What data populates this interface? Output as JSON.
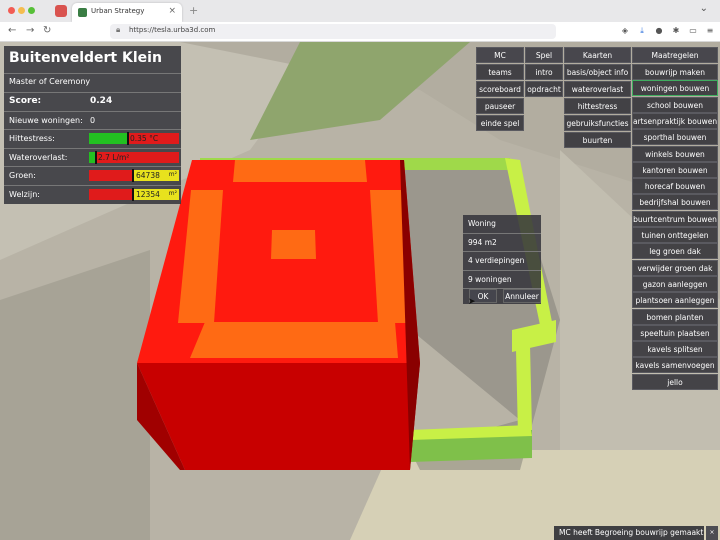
{
  "browser": {
    "tab_title": "Urban Strategy",
    "tab_close": "×",
    "new_tab": "+",
    "menu": "⌄",
    "url": "https://tesla.urba3d.com",
    "back": "←",
    "forward": "→",
    "reload": "↻"
  },
  "panel": {
    "title": "Buitenveldert Klein",
    "role": "Master of Ceremony",
    "score_label": "Score:",
    "score_value": "0.24",
    "woningen_label": "Nieuwe woningen:",
    "woningen_value": "0",
    "hittestress_label": "Hittestress:",
    "hittestress_value": "0.35 °C",
    "hittestress_fill": 0.42,
    "wateroverlast_label": "Wateroverlast:",
    "wateroverlast_value": "2.7 L/m²",
    "wateroverlast_fill": 0.07,
    "groen_label": "Groen:",
    "groen_value": "64738",
    "groen_unit": "m²",
    "groen_fill": 0.5,
    "welzijn_label": "Welzijn:",
    "welzijn_value": "12354",
    "welzijn_unit": "m²",
    "welzijn_fill": 0.5,
    "colors": {
      "bar_red": "#e01b1b",
      "bar_green": "#23c021",
      "bar_yellow": "#e8e21d"
    }
  },
  "menu": {
    "mc": {
      "header": "MC",
      "items": [
        "teams",
        "scoreboard",
        "pauseer",
        "einde spel"
      ]
    },
    "spel": {
      "header": "Spel",
      "items": [
        "intro",
        "opdracht"
      ]
    },
    "kaarten": {
      "header": "Kaarten",
      "items": [
        "basis/object info",
        "wateroverlast",
        "hittestress",
        "gebruiksfuncties",
        "buurten"
      ]
    },
    "maatregelen": {
      "header": "Maatregelen",
      "selected": 1,
      "items": [
        "bouwrijp maken",
        "woningen bouwen",
        "school bouwen",
        "artsenpraktijk bouwen",
        "sporthal bouwen",
        "winkels bouwen",
        "kantoren bouwen",
        "horecaf bouwen",
        "bedrijfshal bouwen",
        "buurtcentrum bouwen",
        "tuinen onttegelen",
        "leg groen dak",
        "verwijder groen dak",
        "gazon aanleggen",
        "plantsoen aanleggen",
        "bomen planten",
        "speeltuin plaatsen",
        "kavels splitsen",
        "kavels samenvoegen",
        "jello"
      ]
    }
  },
  "popup": {
    "title": "Woning",
    "area": "994 m2",
    "floors": "4 verdiepingen",
    "units": "9 woningen",
    "ok": "OK",
    "cancel": "Annuleer"
  },
  "status": {
    "message": "MC heeft Begroeing bouwrijp gemaakt",
    "close": "×"
  }
}
